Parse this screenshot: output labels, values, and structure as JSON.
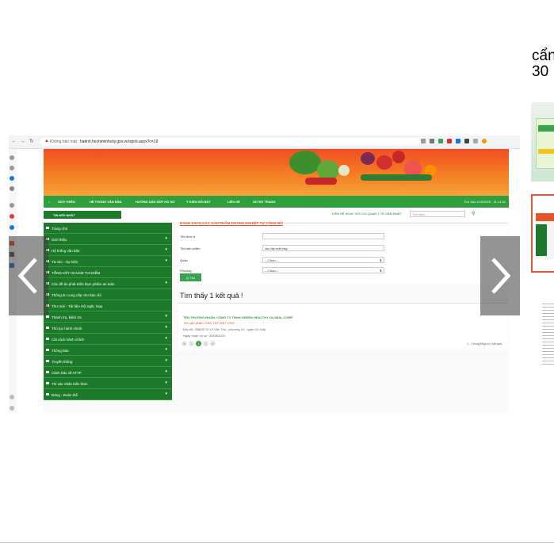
{
  "viewer": {
    "caption_line1": "cẩn",
    "caption_line2": "30",
    "prev_icon": "chevron-left-icon",
    "next_icon": "chevron-right-icon"
  },
  "browser": {
    "security_warning": "Không bảo mật",
    "url": "hatinh.hochiminhcity.gov.vn/spcb.aspx?c=19"
  },
  "site": {
    "menu": [
      "GIỚI THIỆU",
      "HỆ THỐNG VĂN BẢN",
      "HƯỚNG DẪN NỘP HỒ SƠ",
      "Ý KIẾN NỘI BẬT",
      "LIÊN HỆ",
      "SƠ ĐỒ TRANG"
    ],
    "date": "Thứ Sáu 11/9/2020 - 11:14:41",
    "news_badge": "TIN MỚI NHẤT",
    "contact": "LIÊN HỆ NGAY VỚI CƠ QUAN Y TẾ GẦN NHẤT",
    "search_placeholder": "Tìm kiếm...",
    "sidebar": [
      {
        "label": "Trang chủ",
        "caret": false
      },
      {
        "label": "Giới thiệu",
        "caret": true
      },
      {
        "label": "Hệ thống văn bản",
        "caret": true
      },
      {
        "label": "Tin tức - Sự kiện",
        "caret": true
      },
      {
        "label": "TỔNG KẾT 03 NĂM THÍ ĐIỂM",
        "caret": false
      },
      {
        "label": "Các đề án phát triển thực phẩm an toàn",
        "caret": true
      },
      {
        "label": "Thông tin cung cấp cho báo chí",
        "caret": false
      },
      {
        "label": "Thư mời - Tài liệu Hội nghị, Họp",
        "caret": false
      },
      {
        "label": "Thanh tra, kiểm tra",
        "caret": true
      },
      {
        "label": "Thủ tục hành chính",
        "caret": true
      },
      {
        "label": "Cải cách hành chính",
        "caret": true
      },
      {
        "label": "Thông báo",
        "caret": true
      },
      {
        "label": "Truyền thông",
        "caret": true
      },
      {
        "label": "Cảnh báo về ATTP",
        "caret": true
      },
      {
        "label": "Thí xác nhận kiến thức",
        "caret": true
      },
      {
        "label": "Đảng - Đoàn thể",
        "caret": true
      }
    ],
    "form": {
      "title": "DANH SÁCH CÁC SẢN PHẨM DOANH NGHIỆP TỰ CÔNG BỐ",
      "org_label": "Tên đơn vị",
      "org_value": "",
      "product_label": "Tên sản phẩm",
      "product_value": "cần tây mật ong",
      "district_label": "Quận",
      "district_value": "---Chọn---",
      "ward_label": "Phường",
      "ward_value": "---Chọn---",
      "submit_label": "Q Tìm"
    },
    "results": {
      "heading": "Tìm thấy 1 kết quả !",
      "company": "TÊN THƯƠNG NHÂN: CÔNG TY TNHH GREEN HEALTHY GLOBAL CORP",
      "product": "Tên sản phẩm: CẦN TÂY MẬT ONG",
      "address": "Địa chỉ: 308/58 Tô Lê Văn Thọ , phường 14 , quận Gò Vấp",
      "date": "Ngày nhận hồ sơ: 20/08/2020",
      "pages": [
        "«",
        "‹",
        "1",
        "›",
        "»"
      ],
      "page_info": "1 - 1 trong tổng số 1 kết quả"
    }
  }
}
